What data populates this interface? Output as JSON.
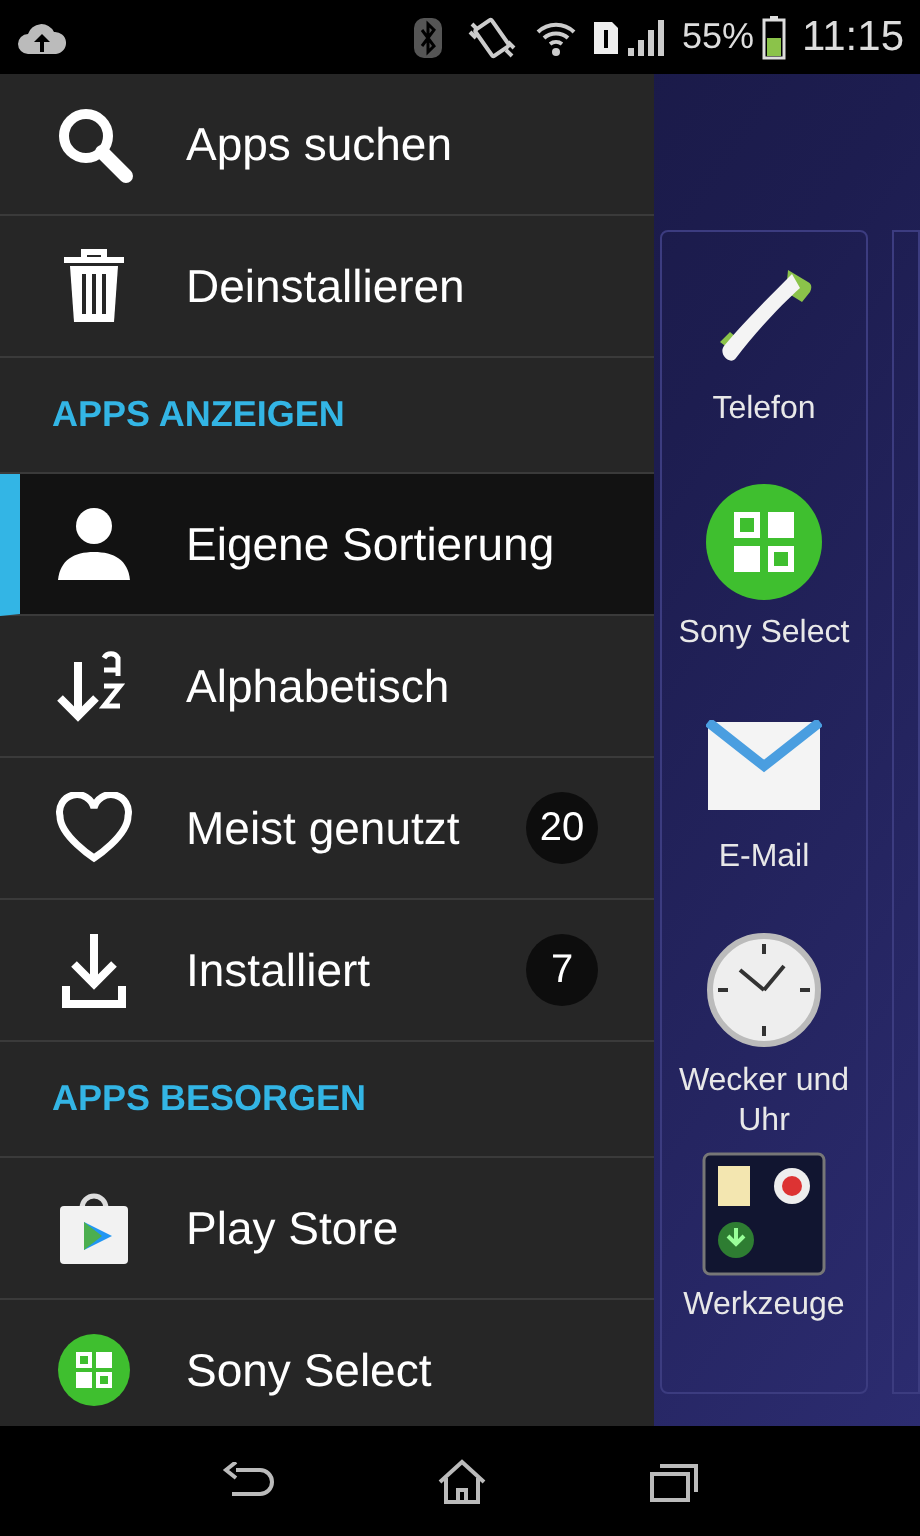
{
  "status_bar": {
    "battery": "55%",
    "time": "11:15"
  },
  "drawer": {
    "sections": [
      {
        "items": [
          {
            "label": "Apps suchen",
            "selected": false
          },
          {
            "label": "Deinstallieren",
            "selected": false
          }
        ]
      },
      {
        "header": "APPS ANZEIGEN",
        "items": [
          {
            "label": "Eigene Sortierung",
            "selected": true
          },
          {
            "label": "Alphabetisch",
            "selected": false
          },
          {
            "label": "Meist genutzt",
            "selected": false,
            "count": "20"
          },
          {
            "label": "Installiert",
            "selected": false,
            "count": "7"
          }
        ]
      },
      {
        "header": "APPS BESORGEN",
        "items": [
          {
            "label": "Play Store",
            "selected": false
          },
          {
            "label": "Sony Select",
            "selected": false
          }
        ]
      }
    ]
  },
  "home_apps": [
    {
      "label": "Telefon"
    },
    {
      "label": "Sony Select"
    },
    {
      "label": "E-Mail"
    },
    {
      "label": "Wecker und Uhr"
    },
    {
      "label": "Werkzeuge"
    }
  ]
}
